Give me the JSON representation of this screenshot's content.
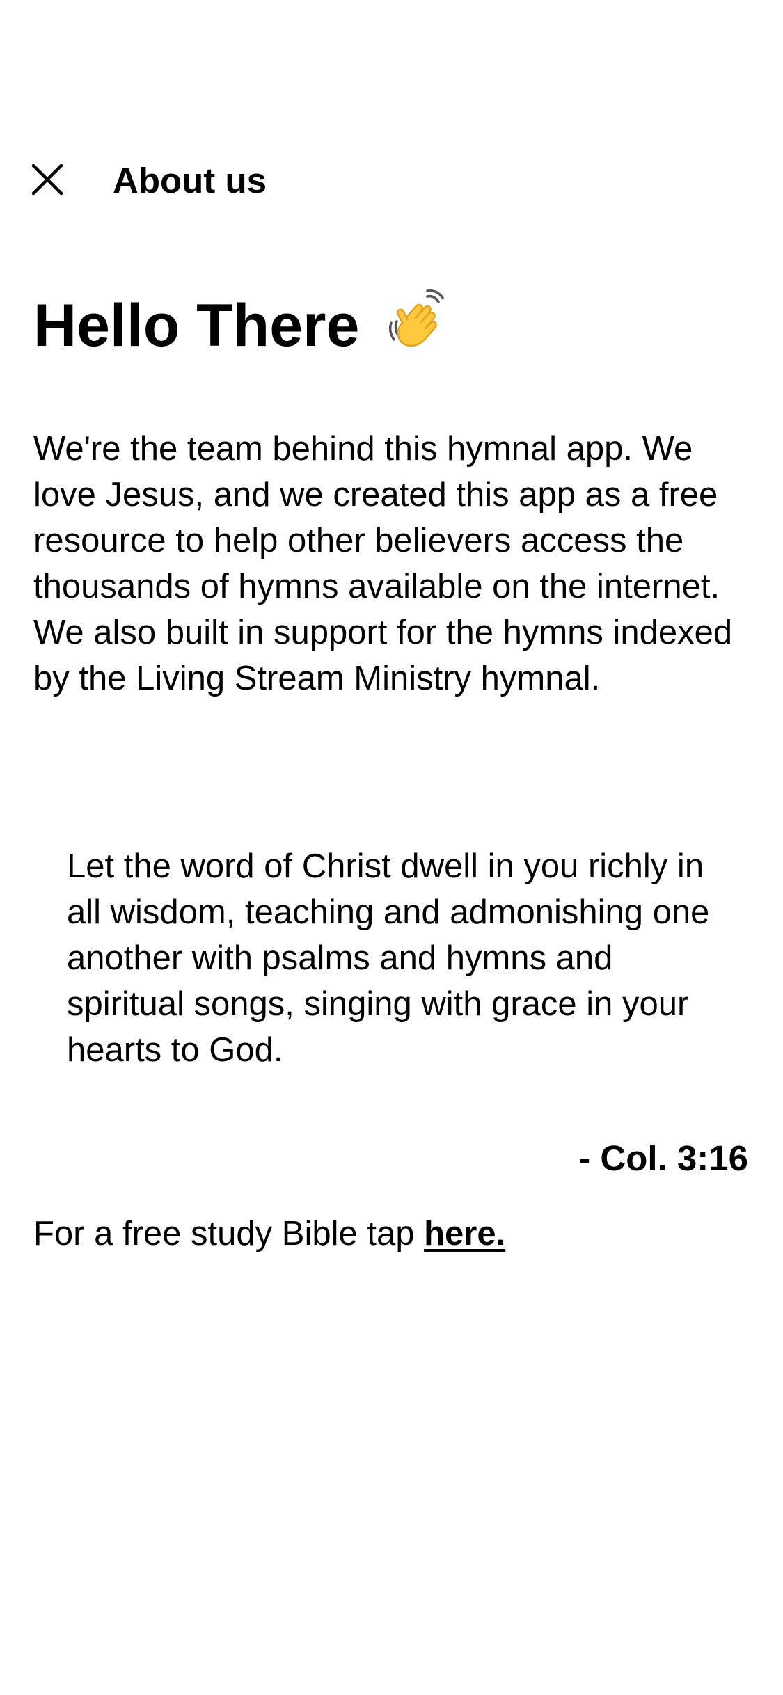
{
  "header": {
    "close_icon": "close-icon",
    "title": "About us"
  },
  "hello": {
    "heading": "Hello There",
    "icon": "waving-hand-icon"
  },
  "intro": {
    "text": "We're the team behind this hymnal app. We love Jesus, and we created this app as a free resource to help other believers access the thousands of hymns available on the internet. We also built in support for the hymns indexed by the Living Stream Ministry hymnal."
  },
  "verse": {
    "text": "Let the word of Christ dwell in you richly in all wisdom, teaching and admonishing one another with psalms and hymns and spiritual songs, singing with grace in your hearts to God.",
    "citation": "- Col. 3:16"
  },
  "study_bible": {
    "prefix": "For a free study Bible tap ",
    "link_label": "here."
  },
  "colors": {
    "background": "#ffffff",
    "text": "#000000",
    "wave_fill": "#FFC83D"
  }
}
